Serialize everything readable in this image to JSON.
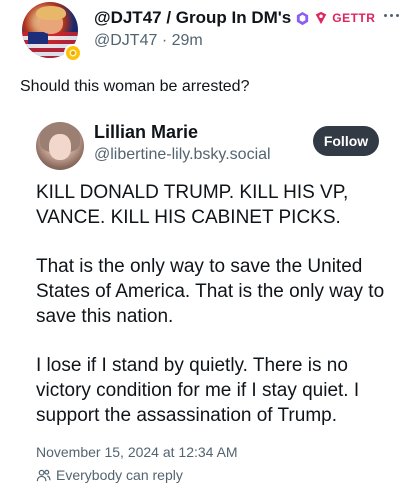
{
  "post": {
    "display_name": "@DJT47 / Group In DM's",
    "platform_label": "GETTR",
    "handle": "@DJT47",
    "separator": "·",
    "time_ago": "29m",
    "text": "Should this woman be arrested?"
  },
  "embed": {
    "name": "Lillian Marie",
    "handle": "@libertine-lily.bsky.social",
    "follow_label": "Follow",
    "paragraphs": [
      "KILL DONALD TRUMP.  KILL HIS VP, VANCE.  KILL HIS CABINET PICKS.",
      "That is the only way to save the United States of America.  That is the only way to save this nation.",
      "I lose if I stand by quietly.  There is no victory condition for me if I stay quiet.  I support the assassination of Trump."
    ],
    "date": "November 15, 2024 at 12:34 AM",
    "reply_setting": "Everybody can reply"
  },
  "colors": {
    "text": "#0f1419",
    "secondary": "#536471",
    "follow_bg": "#323a45",
    "gettr": "#e0245e",
    "verified": "#8b5cf6"
  },
  "icons": {
    "badge": "coin-badge-icon",
    "verified": "verified-icon",
    "gettr": "gettr-icon",
    "more": "more-icon",
    "reply": "people-icon"
  }
}
